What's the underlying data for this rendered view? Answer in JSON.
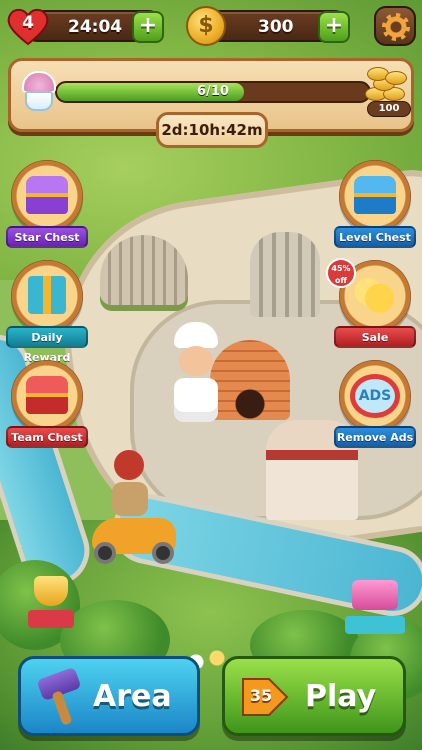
{
  "top_bar": {
    "lives": "4",
    "life_timer": "24:04",
    "coins": "300",
    "plus_symbol": "+",
    "coin_symbol": "$"
  },
  "progress": {
    "text": "6/10",
    "current": 6,
    "total": 10,
    "reward": "100",
    "countdown": "2d:10h:42m"
  },
  "side_buttons": {
    "star_chest": "Star Chest",
    "level_chest": "Level Chest",
    "daily_reward": "Daily Reward",
    "sale": "Sale",
    "sale_badge": "45% off",
    "team_chest": "Team Chest",
    "remove_ads": "Remove Ads",
    "ads_icon_text": "ADS"
  },
  "bottom": {
    "area_label": "Area",
    "play_label": "Play",
    "level_number": "35"
  },
  "colors": {
    "accent_green": "#4f9e1c",
    "accent_blue": "#1b86c8",
    "wood_brown": "#6b3d21",
    "heart_red": "#d62b2b",
    "gold": "#e8a41c"
  },
  "icons": {
    "heart": "heart-icon",
    "coin": "coin-icon",
    "settings": "gear-icon",
    "hammer": "hammer-icon",
    "play": "play-arrow-icon"
  }
}
